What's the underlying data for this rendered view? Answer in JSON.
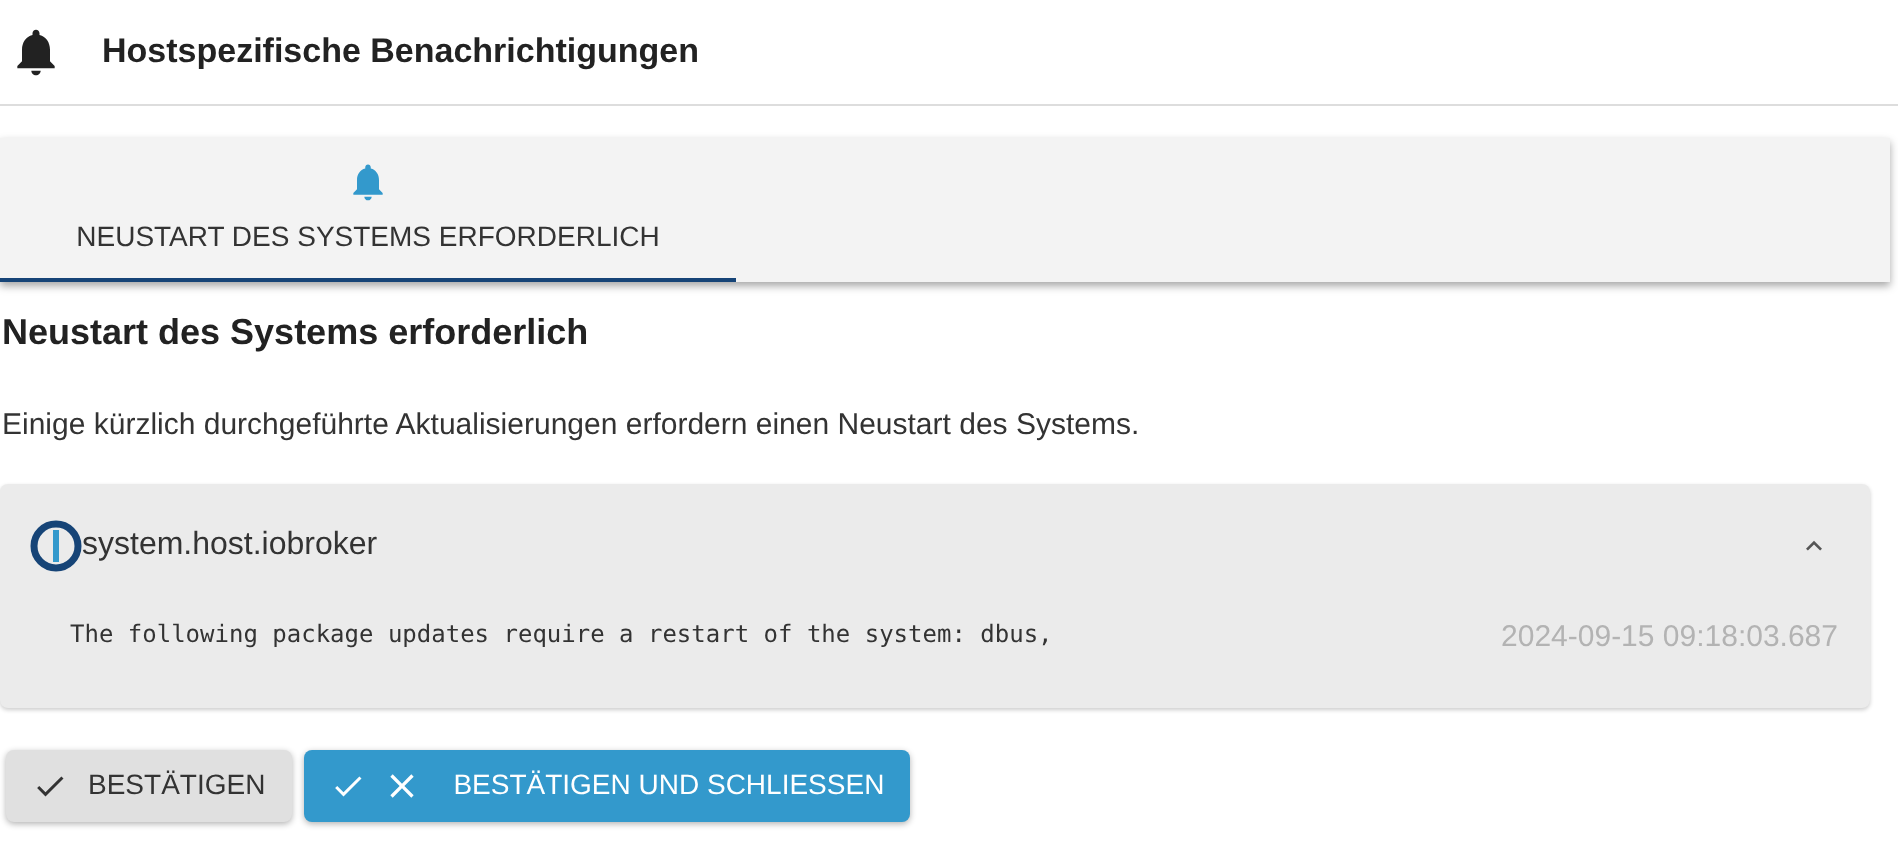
{
  "header": {
    "title": "Hostspezifische Benachrichtigungen"
  },
  "tabs": [
    {
      "label": "NEUSTART DES SYSTEMS ERFORDERLICH",
      "selected": true
    }
  ],
  "section": {
    "title": "Neustart des Systems erforderlich",
    "description": "Einige kürzlich durchgeführte Aktualisierungen erfordern einen Neustart des Systems."
  },
  "notifications": [
    {
      "host": "system.host.iobroker",
      "expanded": true,
      "message": "The following package updates require a restart of the system: dbus,",
      "timestamp": "2024-09-15 09:18:03.687"
    }
  ],
  "buttons": [
    {
      "label": "BESTÄTIGEN",
      "kind": "secondary"
    },
    {
      "label": "BESTÄTIGEN UND SCHLIESSEN",
      "kind": "primary"
    }
  ]
}
